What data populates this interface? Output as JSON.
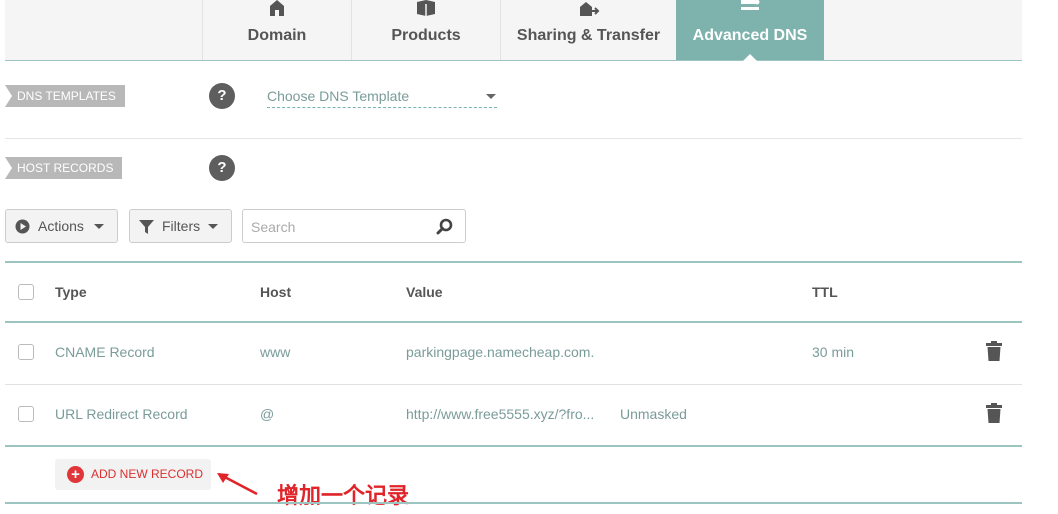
{
  "tabs": [
    {
      "label": "Domain",
      "icon": "home-icon",
      "active": false
    },
    {
      "label": "Products",
      "icon": "box-icon",
      "active": false
    },
    {
      "label": "Sharing & Transfer",
      "icon": "transfer-icon",
      "active": false
    },
    {
      "label": "Advanced DNS",
      "icon": "dns-icon",
      "active": true
    }
  ],
  "dns_templates": {
    "tag": "DNS TEMPLATES",
    "help": "?",
    "select_value": "Choose DNS Template"
  },
  "host_records": {
    "tag": "HOST RECORDS",
    "help": "?"
  },
  "toolbar": {
    "actions_label": "Actions",
    "filters_label": "Filters",
    "search_placeholder": "Search"
  },
  "table": {
    "headers": {
      "type": "Type",
      "host": "Host",
      "value": "Value",
      "ttl": "TTL"
    },
    "rows": [
      {
        "type": "CNAME Record",
        "host": "www",
        "value": "parkingpage.namecheap.com.",
        "extra": "",
        "ttl": "30 min"
      },
      {
        "type": "URL Redirect Record",
        "host": "@",
        "value": "http://www.free5555.xyz/?fro...",
        "extra": "Unmasked",
        "ttl": ""
      }
    ]
  },
  "add_record": {
    "label": "ADD NEW RECORD"
  },
  "annotation": {
    "text": "增加一个记录"
  },
  "colors": {
    "accent": "#7db2ad",
    "danger": "#e0363a",
    "annotation": "#e0242a"
  }
}
